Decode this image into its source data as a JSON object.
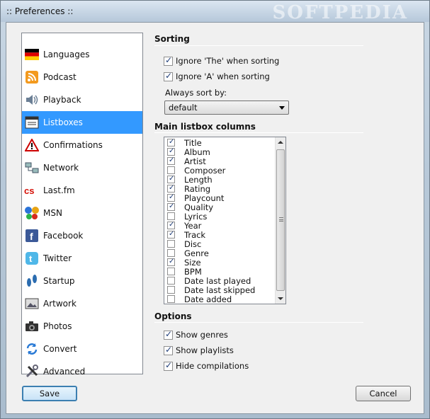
{
  "window": {
    "title": ":: Preferences ::",
    "watermark": "SOFTPEDIA"
  },
  "sidebar": {
    "items": [
      {
        "label": "Languages",
        "icon": "flag-icon",
        "selected": false
      },
      {
        "label": "Podcast",
        "icon": "rss-icon",
        "selected": false
      },
      {
        "label": "Playback",
        "icon": "speaker-icon",
        "selected": false
      },
      {
        "label": "Listboxes",
        "icon": "listbox-icon",
        "selected": true
      },
      {
        "label": "Confirmations",
        "icon": "warning-icon",
        "selected": false
      },
      {
        "label": "Network",
        "icon": "network-icon",
        "selected": false
      },
      {
        "label": "Last.fm",
        "icon": "lastfm-icon",
        "selected": false
      },
      {
        "label": "MSN",
        "icon": "msn-butterfly-icon",
        "selected": false
      },
      {
        "label": "Facebook",
        "icon": "facebook-icon",
        "selected": false
      },
      {
        "label": "Twitter",
        "icon": "twitter-icon",
        "selected": false
      },
      {
        "label": "Startup",
        "icon": "footprints-icon",
        "selected": false
      },
      {
        "label": "Artwork",
        "icon": "artwork-icon",
        "selected": false
      },
      {
        "label": "Photos",
        "icon": "camera-icon",
        "selected": false
      },
      {
        "label": "Convert",
        "icon": "convert-icon",
        "selected": false
      },
      {
        "label": "Advanced",
        "icon": "tools-icon",
        "selected": false
      }
    ]
  },
  "sorting": {
    "title": "Sorting",
    "ignore_the": {
      "label": "Ignore 'The' when sorting",
      "checked": true
    },
    "ignore_a": {
      "label": "Ignore 'A' when sorting",
      "checked": true
    },
    "always_sort_label": "Always sort by:",
    "always_sort_value": "default"
  },
  "columns": {
    "title": "Main listbox columns",
    "items": [
      {
        "label": "Title",
        "checked": true
      },
      {
        "label": "Album",
        "checked": true
      },
      {
        "label": "Artist",
        "checked": true
      },
      {
        "label": "Composer",
        "checked": false
      },
      {
        "label": "Length",
        "checked": true
      },
      {
        "label": "Rating",
        "checked": true
      },
      {
        "label": "Playcount",
        "checked": true
      },
      {
        "label": "Quality",
        "checked": true
      },
      {
        "label": "Lyrics",
        "checked": false
      },
      {
        "label": "Year",
        "checked": true
      },
      {
        "label": "Track",
        "checked": true
      },
      {
        "label": "Disc",
        "checked": false
      },
      {
        "label": "Genre",
        "checked": false
      },
      {
        "label": "Size",
        "checked": true
      },
      {
        "label": "BPM",
        "checked": false
      },
      {
        "label": "Date last played",
        "checked": false
      },
      {
        "label": "Date last skipped",
        "checked": false
      },
      {
        "label": "Date added",
        "checked": false
      }
    ]
  },
  "options": {
    "title": "Options",
    "show_genres": {
      "label": "Show genres",
      "checked": true
    },
    "show_playlists": {
      "label": "Show playlists",
      "checked": true
    },
    "hide_compilations": {
      "label": "Hide compilations",
      "checked": true
    }
  },
  "buttons": {
    "save": "Save",
    "cancel": "Cancel"
  }
}
